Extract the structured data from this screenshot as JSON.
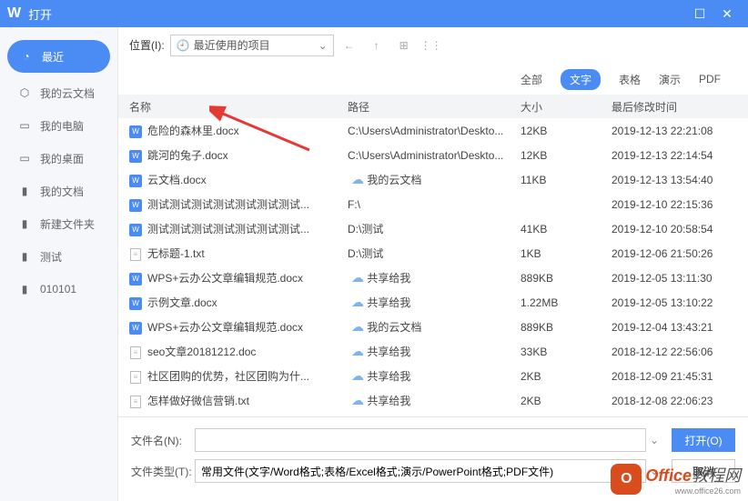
{
  "titlebar": {
    "title": "打开"
  },
  "sidebar": {
    "items": [
      {
        "label": "最近"
      },
      {
        "label": "我的云文档"
      },
      {
        "label": "我的电脑"
      },
      {
        "label": "我的桌面"
      },
      {
        "label": "我的文档"
      },
      {
        "label": "新建文件夹"
      },
      {
        "label": "测试"
      },
      {
        "label": "010101"
      }
    ]
  },
  "toolbar": {
    "location_label": "位置(I):",
    "location_value": "最近使用的项目"
  },
  "filters": {
    "items": [
      {
        "label": "全部"
      },
      {
        "label": "文字"
      },
      {
        "label": "表格"
      },
      {
        "label": "演示"
      },
      {
        "label": "PDF"
      }
    ]
  },
  "columns": {
    "name": "名称",
    "path": "路径",
    "size": "大小",
    "time": "最后修改时间"
  },
  "rows": [
    {
      "icon": "doc",
      "name": "危险的森林里.docx",
      "cloud": false,
      "path": "C:\\Users\\Administrator\\Deskto...",
      "size": "12KB",
      "time": "2019-12-13 22:21:08"
    },
    {
      "icon": "doc",
      "name": "跳河的兔子.docx",
      "cloud": false,
      "path": "C:\\Users\\Administrator\\Deskto...",
      "size": "12KB",
      "time": "2019-12-13 22:14:54"
    },
    {
      "icon": "doc",
      "name": "云文档.docx",
      "cloud": true,
      "path": "我的云文档",
      "size": "11KB",
      "time": "2019-12-13 13:54:40"
    },
    {
      "icon": "doc",
      "name": "测试测试测试测试测试测试测试...",
      "cloud": false,
      "path": "F:\\",
      "size": "",
      "time": "2019-12-10 22:15:36"
    },
    {
      "icon": "doc",
      "name": "测试测试测试测试测试测试测试...",
      "cloud": false,
      "path": "D:\\测试",
      "size": "41KB",
      "time": "2019-12-10 20:58:54"
    },
    {
      "icon": "txt",
      "name": "无标题-1.txt",
      "cloud": false,
      "path": "D:\\测试",
      "size": "1KB",
      "time": "2019-12-06 21:50:26"
    },
    {
      "icon": "doc",
      "name": "WPS+云办公文章编辑规范.docx",
      "cloud": true,
      "path": "共享给我",
      "size": "889KB",
      "time": "2019-12-05 13:11:30"
    },
    {
      "icon": "doc",
      "name": "示例文章.docx",
      "cloud": true,
      "path": "共享给我",
      "size": "1.22MB",
      "time": "2019-12-05 13:10:22"
    },
    {
      "icon": "doc",
      "name": "WPS+云办公文章编辑规范.docx",
      "cloud": true,
      "path": "我的云文档",
      "size": "889KB",
      "time": "2019-12-04 13:43:21"
    },
    {
      "icon": "txt",
      "name": "seo文章20181212.doc",
      "cloud": true,
      "path": "共享给我",
      "size": "33KB",
      "time": "2018-12-12 22:56:06"
    },
    {
      "icon": "txt",
      "name": "社区团购的优势，社区团购为什...",
      "cloud": true,
      "path": "共享给我",
      "size": "2KB",
      "time": "2018-12-09 21:45:31"
    },
    {
      "icon": "txt",
      "name": "怎样做好微信营销.txt",
      "cloud": true,
      "path": "共享给我",
      "size": "2KB",
      "time": "2018-12-08 22:06:23"
    }
  ],
  "footer": {
    "filename_label": "文件名(N):",
    "filename_value": "",
    "filetype_label": "文件类型(T):",
    "filetype_value": "常用文件(文字/Word格式;表格/Excel格式;演示/PowerPoint格式;PDF文件)",
    "open_btn": "打开(O)",
    "cancel_btn": "取消"
  },
  "watermark": {
    "brand": "Office",
    "suffix": "教程网",
    "sub": "www.office26.com"
  }
}
